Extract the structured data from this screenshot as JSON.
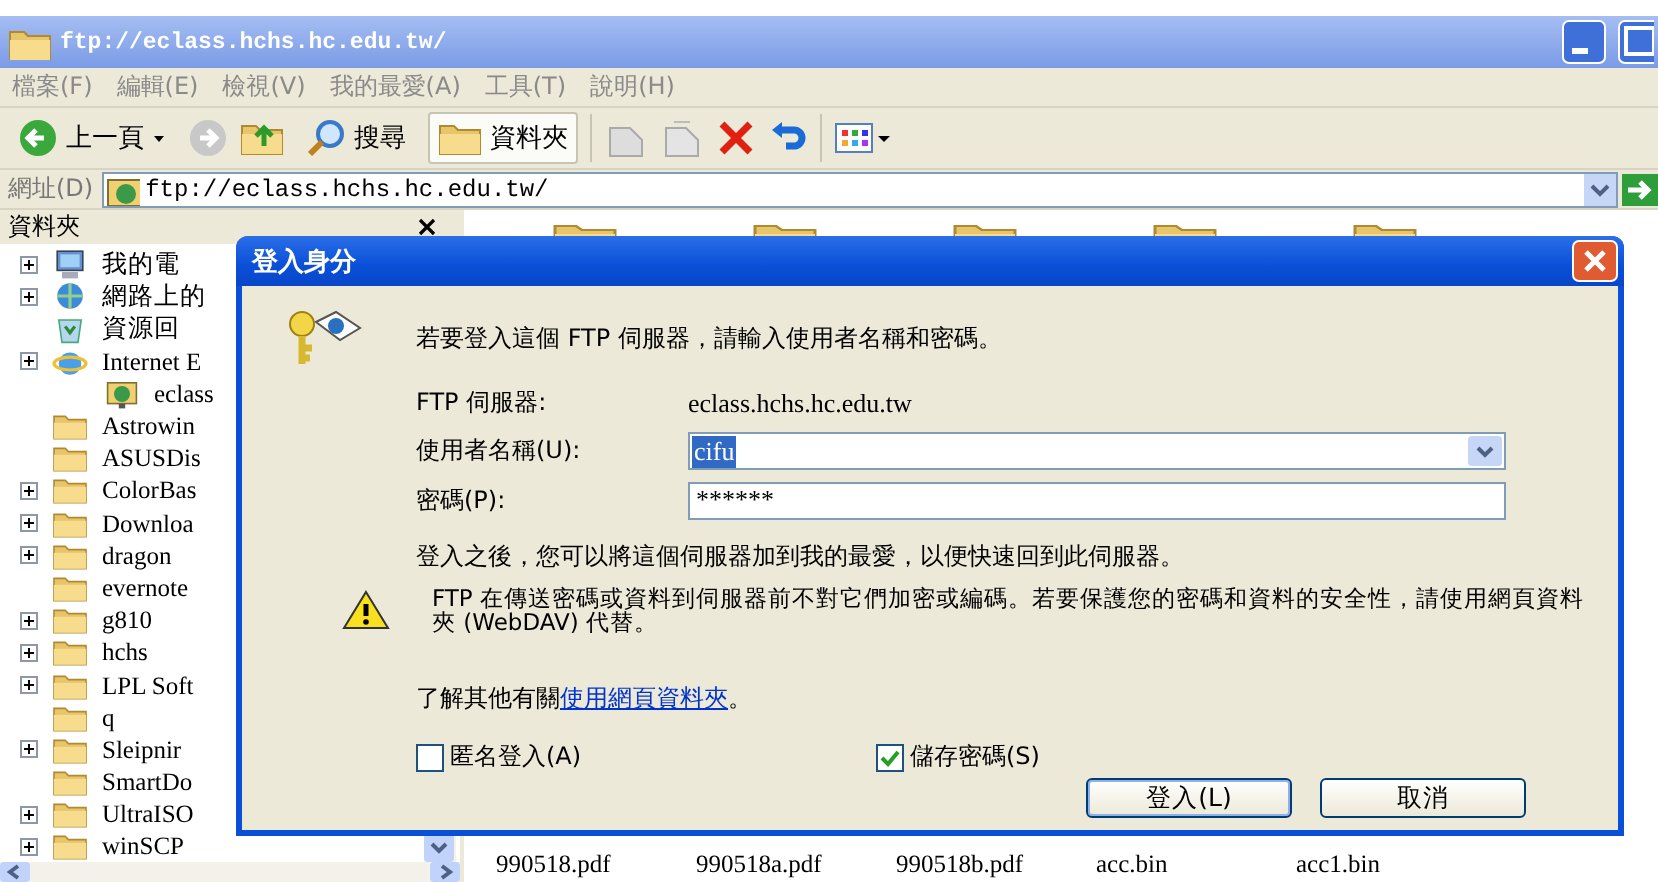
{
  "window": {
    "title": "ftp://eclass.hchs.hc.edu.tw/"
  },
  "menu": [
    "檔案(F)",
    "編輯(E)",
    "檢視(V)",
    "我的最愛(A)",
    "工具(T)",
    "說明(H)"
  ],
  "toolbar": [
    {
      "kind": "back",
      "label": "上一頁"
    },
    {
      "kind": "forward"
    },
    {
      "kind": "up"
    },
    {
      "kind": "search",
      "label": "搜尋"
    },
    {
      "kind": "folders",
      "label": "資料夾",
      "selected": true
    },
    {
      "kind": "move"
    },
    {
      "kind": "copy"
    },
    {
      "kind": "delete"
    },
    {
      "kind": "undo"
    },
    {
      "kind": "views"
    }
  ],
  "address": {
    "label": "網址(D)",
    "value": "ftp://eclass.hchs.hc.edu.tw/"
  },
  "folders_pane": {
    "title": "資料夾",
    "items": [
      {
        "kind": "computer",
        "label": "我的電",
        "expandable": true
      },
      {
        "kind": "network",
        "label": "網路上的",
        "expandable": true
      },
      {
        "kind": "recycle",
        "label": "資源回",
        "expandable": false
      },
      {
        "kind": "browser",
        "label": "Internet E",
        "expandable": true,
        "children": [
          {
            "kind": "ftp",
            "label": "eclass",
            "expandable": false
          }
        ]
      },
      {
        "kind": "folder",
        "label": "Astrowin",
        "expandable": false
      },
      {
        "kind": "folder",
        "label": "ASUSDis",
        "expandable": false
      },
      {
        "kind": "folder",
        "label": "ColorBas",
        "expandable": true
      },
      {
        "kind": "folder",
        "label": "Downloa",
        "expandable": true
      },
      {
        "kind": "folder",
        "label": "dragon",
        "expandable": true
      },
      {
        "kind": "folder",
        "label": "evernote",
        "expandable": false
      },
      {
        "kind": "folder",
        "label": "g810",
        "expandable": true
      },
      {
        "kind": "folder",
        "label": "hchs",
        "expandable": true
      },
      {
        "kind": "folder",
        "label": "LPL Soft",
        "expandable": true
      },
      {
        "kind": "folder",
        "label": "q",
        "expandable": false
      },
      {
        "kind": "folder",
        "label": "Sleipnir",
        "expandable": true
      },
      {
        "kind": "folder",
        "label": "SmartDo",
        "expandable": false
      },
      {
        "kind": "folder",
        "label": "UltraISO",
        "expandable": true
      },
      {
        "kind": "folder",
        "label": "winSCP",
        "expandable": true
      }
    ]
  },
  "files": {
    "folders": [
      {
        "kind": "folder"
      },
      {
        "kind": "folder"
      },
      {
        "kind": "folder"
      },
      {
        "kind": "folder"
      },
      {
        "kind": "folder"
      }
    ],
    "names": [
      "990518.pdf",
      "990518a.pdf",
      "990518b.pdf",
      "acc.bin",
      "acc1.bin"
    ]
  },
  "dialog": {
    "title": "登入身分",
    "intro": "若要登入這個 FTP 伺服器，請輸入使用者名稱和密碼。",
    "server_label": "FTP 伺服器:",
    "server_value": "eclass.hchs.hc.edu.tw",
    "username": {
      "label": "使用者名稱(U):",
      "value": "cifu",
      "highlighted": true
    },
    "password": {
      "label": "密碼(P):",
      "value": "******"
    },
    "info": "登入之後，您可以將這個伺服器加到我的最愛，以便快速回到此伺服器。",
    "warning": "FTP 在傳送密碼或資料到伺服器前不對它們加密或編碼。若要保護您的密碼和資料的安全性，請使用網頁資料夾 (WebDAV) 代替。",
    "learn_more": {
      "text": "了解其他有關",
      "link": "使用網頁資料夾",
      "end": "。"
    },
    "checkboxes": [
      {
        "label": "匿名登入(A)",
        "checked": false
      },
      {
        "label": "儲存密碼(S)",
        "checked": true
      }
    ],
    "buttons": [
      {
        "label": "登入(L)",
        "default": true
      },
      {
        "label": "取消",
        "default": false
      }
    ]
  }
}
